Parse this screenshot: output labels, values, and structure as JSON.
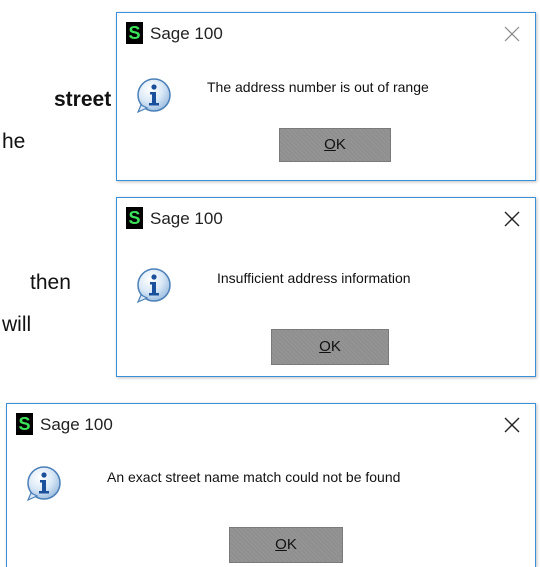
{
  "background_text": {
    "line1": "street",
    "line2": "he",
    "line3": "then",
    "line4": "will"
  },
  "dialogs": [
    {
      "title": "Sage 100",
      "logo_letter": "S",
      "message": "The address number is out of range",
      "ok_mnemonic": "O",
      "ok_rest": "K"
    },
    {
      "title": "Sage 100",
      "logo_letter": "S",
      "message": "Insufficient address information",
      "ok_mnemonic": "O",
      "ok_rest": "K"
    },
    {
      "title": "Sage 100",
      "logo_letter": "S",
      "message": "An exact street name match could not be found",
      "ok_mnemonic": "O",
      "ok_rest": "K"
    }
  ],
  "icons": {
    "info": "info-icon",
    "close": "close-icon",
    "logo": "sage-logo-icon"
  },
  "colors": {
    "dialog_border": "#3b8fd8",
    "logo_bg": "#000000",
    "logo_fg": "#3be35a",
    "info_blue": "#1a6fc0",
    "ok_button": "#8f8f8f"
  }
}
